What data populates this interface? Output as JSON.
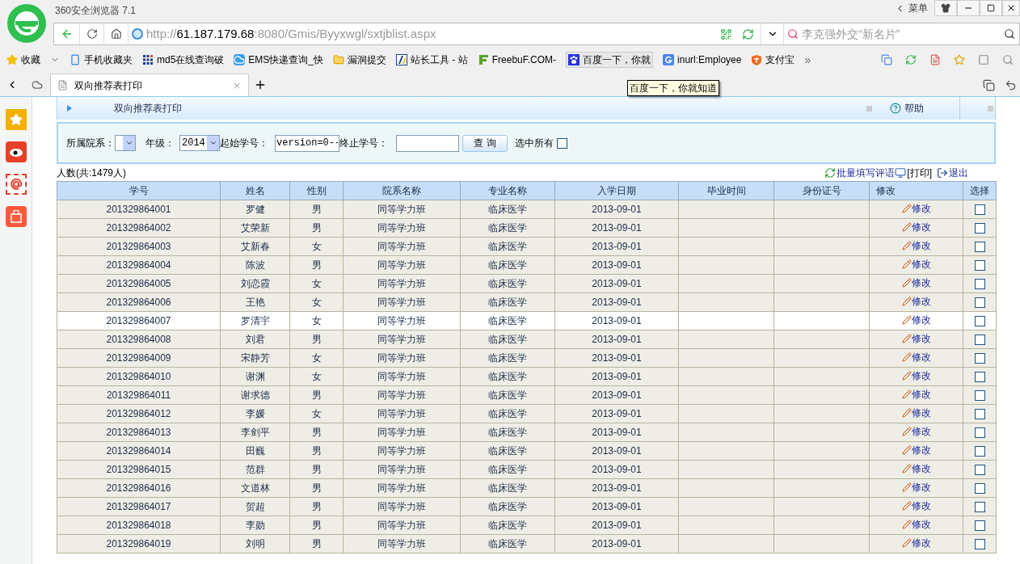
{
  "browser": {
    "title": "360安全浏览器 7.1",
    "menu": "菜单",
    "url": {
      "scheme": "http://",
      "host": "61.187.179.68",
      "rest": ":8080/Gmis/Byyxwgl/sxtjblist.aspx"
    },
    "search": {
      "placeholder": "李克强外交“新名片”"
    },
    "bookmarks": [
      {
        "label": "收藏",
        "kind": "star"
      },
      {
        "label": "手机收藏夹",
        "kind": "phone"
      },
      {
        "label": "md5在线查询破",
        "kind": "grid"
      },
      {
        "label": "EMS快递查询_快",
        "kind": "cloud"
      },
      {
        "label": "漏洞提交",
        "kind": "folder"
      },
      {
        "label": "站长工具 - 站",
        "kind": "tool"
      },
      {
        "label": "FreebuF.COM-",
        "kind": "freebuf"
      },
      {
        "label": "百度一下，你就",
        "kind": "paw"
      },
      {
        "label": "inurl:Employee",
        "kind": "g"
      },
      {
        "label": "支付宝",
        "kind": "pay"
      }
    ],
    "more": "»",
    "tab": {
      "title": "双向推荐表打印",
      "selected": true
    },
    "tooltip": "百度一下，你就知道"
  },
  "page": {
    "title": "双向推荐表打印",
    "help": "帮助",
    "filters": {
      "dept_label": "所属院系：",
      "grade_label": "年级：",
      "grade_value": "2014",
      "start_label": "起始学号：",
      "start_value": "version=0--",
      "end_label": "终止学号：",
      "query": "查 询",
      "select_all": "选中所有",
      "select_all_checked": false
    },
    "count": "人数(共:1479人)",
    "actions": [
      {
        "label": "批量填写评语",
        "kind": "refresh"
      },
      {
        "label": "[打印]",
        "kind": "computer"
      },
      {
        "label": "退出",
        "kind": "exit"
      }
    ],
    "table": {
      "columns": [
        "学号",
        "姓名",
        "性别",
        "院系名称",
        "专业名称",
        "入学日期",
        "毕业时间",
        "身份证号",
        "修改",
        "选择"
      ],
      "rows": [
        {
          "id": "201329864001",
          "name": "罗健",
          "gender": "男",
          "dept": "同等学力班",
          "major": "临床医学",
          "date": "2013-09-01",
          "edit": "修改",
          "checked": false,
          "selected": false
        },
        {
          "id": "201329864002",
          "name": "艾荣新",
          "gender": "男",
          "dept": "同等学力班",
          "major": "临床医学",
          "date": "2013-09-01",
          "edit": "修改",
          "checked": false,
          "selected": false
        },
        {
          "id": "201329864003",
          "name": "艾新春",
          "gender": "女",
          "dept": "同等学力班",
          "major": "临床医学",
          "date": "2013-09-01",
          "edit": "修改",
          "checked": false,
          "selected": false
        },
        {
          "id": "201329864004",
          "name": "陈波",
          "gender": "男",
          "dept": "同等学力班",
          "major": "临床医学",
          "date": "2013-09-01",
          "edit": "修改",
          "checked": false,
          "selected": false
        },
        {
          "id": "201329864005",
          "name": "刘恋霞",
          "gender": "女",
          "dept": "同等学力班",
          "major": "临床医学",
          "date": "2013-09-01",
          "edit": "修改",
          "checked": false,
          "selected": false
        },
        {
          "id": "201329864006",
          "name": "王艳",
          "gender": "女",
          "dept": "同等学力班",
          "major": "临床医学",
          "date": "2013-09-01",
          "edit": "修改",
          "checked": false,
          "selected": false
        },
        {
          "id": "201329864007",
          "name": "罗清宇",
          "gender": "女",
          "dept": "同等学力班",
          "major": "临床医学",
          "date": "2013-09-01",
          "edit": "修改",
          "checked": false,
          "selected": true
        },
        {
          "id": "201329864008",
          "name": "刘君",
          "gender": "男",
          "dept": "同等学力班",
          "major": "临床医学",
          "date": "2013-09-01",
          "edit": "修改",
          "checked": false,
          "selected": false
        },
        {
          "id": "201329864009",
          "name": "宋静芳",
          "gender": "女",
          "dept": "同等学力班",
          "major": "临床医学",
          "date": "2013-09-01",
          "edit": "修改",
          "checked": false,
          "selected": false
        },
        {
          "id": "201329864010",
          "name": "谢渊",
          "gender": "女",
          "dept": "同等学力班",
          "major": "临床医学",
          "date": "2013-09-01",
          "edit": "修改",
          "checked": false,
          "selected": false
        },
        {
          "id": "201329864011",
          "name": "谢求德",
          "gender": "男",
          "dept": "同等学力班",
          "major": "临床医学",
          "date": "2013-09-01",
          "edit": "修改",
          "checked": false,
          "selected": false
        },
        {
          "id": "201329864012",
          "name": "李媛",
          "gender": "女",
          "dept": "同等学力班",
          "major": "临床医学",
          "date": "2013-09-01",
          "edit": "修改",
          "checked": false,
          "selected": false
        },
        {
          "id": "201329864013",
          "name": "李剑平",
          "gender": "男",
          "dept": "同等学力班",
          "major": "临床医学",
          "date": "2013-09-01",
          "edit": "修改",
          "checked": false,
          "selected": false
        },
        {
          "id": "201329864014",
          "name": "田巍",
          "gender": "男",
          "dept": "同等学力班",
          "major": "临床医学",
          "date": "2013-09-01",
          "edit": "修改",
          "checked": false,
          "selected": false
        },
        {
          "id": "201329864015",
          "name": "范群",
          "gender": "男",
          "dept": "同等学力班",
          "major": "临床医学",
          "date": "2013-09-01",
          "edit": "修改",
          "checked": false,
          "selected": false
        },
        {
          "id": "201329864016",
          "name": "文道林",
          "gender": "男",
          "dept": "同等学力班",
          "major": "临床医学",
          "date": "2013-09-01",
          "edit": "修改",
          "checked": false,
          "selected": false
        },
        {
          "id": "201329864017",
          "name": "贺超",
          "gender": "男",
          "dept": "同等学力班",
          "major": "临床医学",
          "date": "2013-09-01",
          "edit": "修改",
          "checked": false,
          "selected": false
        },
        {
          "id": "201329864018",
          "name": "李勋",
          "gender": "男",
          "dept": "同等学力班",
          "major": "临床医学",
          "date": "2013-09-01",
          "edit": "修改",
          "checked": false,
          "selected": false
        },
        {
          "id": "201329864019",
          "name": "刘明",
          "gender": "男",
          "dept": "同等学力班",
          "major": "临床医学",
          "date": "2013-09-01",
          "edit": "修改",
          "checked": false,
          "selected": false
        }
      ]
    }
  }
}
